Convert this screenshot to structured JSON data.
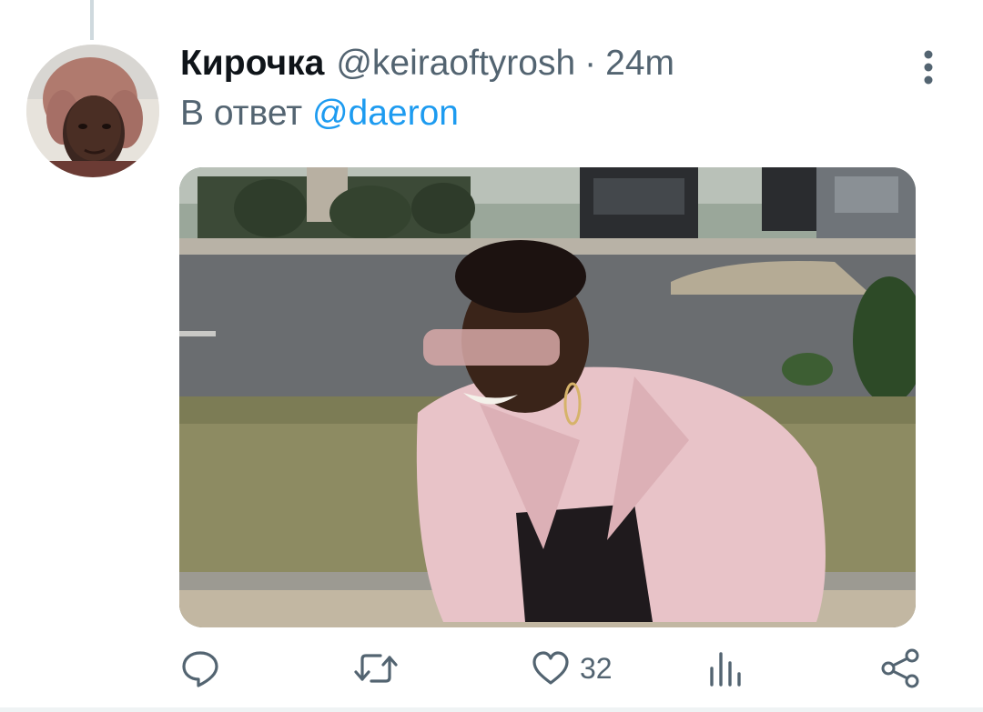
{
  "tweet": {
    "author": {
      "display_name": "Кирочка",
      "handle": "@keiraoftyrosh"
    },
    "separator": "·",
    "time": "24m",
    "reply": {
      "prefix": "В ответ",
      "mention": "@daeron"
    },
    "actions": {
      "reply_icon": "reply-icon",
      "retweet_icon": "retweet-icon",
      "like_icon": "heart-icon",
      "like_count": "32",
      "analytics_icon": "analytics-icon",
      "share_icon": "share-icon"
    }
  },
  "colors": {
    "text_primary": "#0f1419",
    "text_secondary": "#536471",
    "link": "#1d9bf0"
  }
}
